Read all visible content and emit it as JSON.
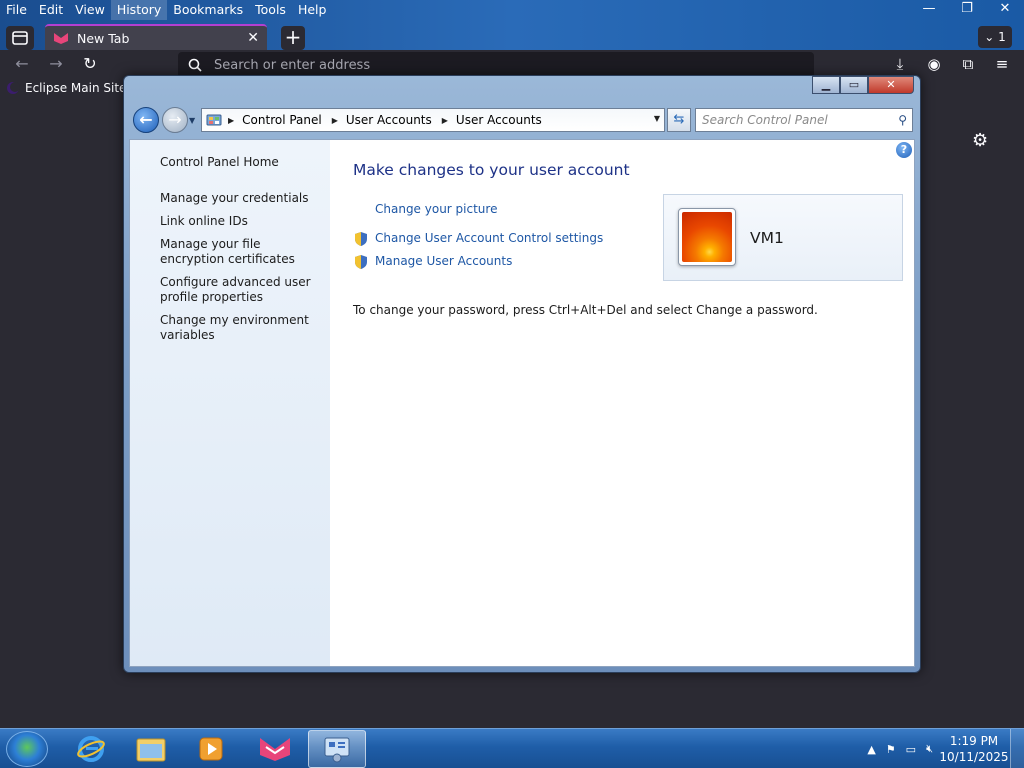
{
  "browser": {
    "menu": [
      {
        "label": "File"
      },
      {
        "label": "Edit"
      },
      {
        "label": "View"
      },
      {
        "label": "History"
      },
      {
        "label": "Bookmarks"
      },
      {
        "label": "Tools"
      },
      {
        "label": "Help"
      }
    ],
    "tab_title": "New Tab",
    "tab_count": "1",
    "url_placeholder": "Search or enter address",
    "bookmark": "Eclipse Main Site"
  },
  "explorer": {
    "breadcrumbs": [
      "Control Panel",
      "User Accounts",
      "User Accounts"
    ],
    "search_placeholder": "Search Control Panel",
    "sidebar": [
      {
        "label": "Control Panel Home"
      },
      {
        "label": "Manage your credentials"
      },
      {
        "label": "Link online IDs"
      },
      {
        "label": "Manage your file encryption certificates"
      },
      {
        "label": "Configure advanced user profile properties"
      },
      {
        "label": "Change my environment variables"
      }
    ],
    "heading": "Make changes to your user account",
    "tasks": [
      {
        "label": "Change your picture",
        "shield": false
      },
      {
        "label": "Change User Account Control settings",
        "shield": true
      },
      {
        "label": "Manage User Accounts",
        "shield": true
      }
    ],
    "username": "VM1",
    "password_text": "To change your password, press Ctrl+Alt+Del and select Change a password."
  },
  "taskbar": {
    "time": "1:19 PM",
    "date": "10/11/2025"
  }
}
